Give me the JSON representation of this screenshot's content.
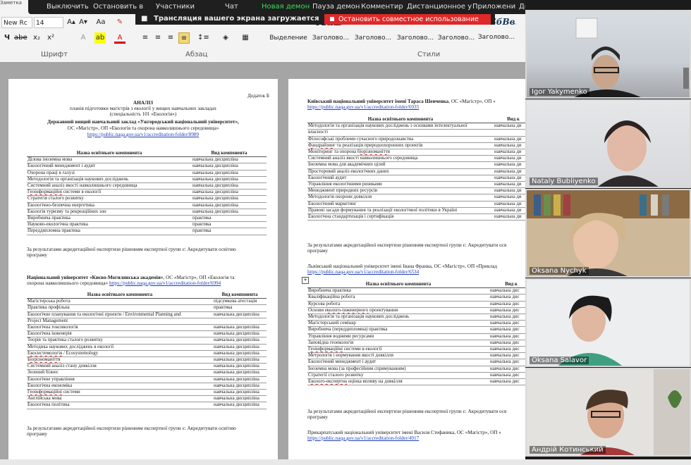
{
  "window": {
    "title_fragment": "Заметка ст"
  },
  "meeting": {
    "controls": [
      "Выключить",
      "Остановить в",
      "Участники",
      "Чат",
      "Новая демон",
      "Пауза демон",
      "Комментир",
      "Дистанционное у",
      "Приложени",
      "Дополнит"
    ],
    "share_status": "Трансляция вашего экрана загружается",
    "stop_share": "Остановить совместное использование"
  },
  "ribbon": {
    "font_name": "New Rc",
    "font_size": "14",
    "font_group": "Шрифт",
    "paragraph_group": "Абзац",
    "styles_group": "Стили",
    "styles": [
      {
        "sample": "АаБбВ",
        "name": "Выделение"
      },
      {
        "sample": "AaB",
        "name": "Заголово..."
      },
      {
        "sample": "АаБбВ",
        "name": "Заголово..."
      },
      {
        "sample": "АаБбВ",
        "name": "Заголово..."
      },
      {
        "sample": "АаБбВ",
        "name": "Заголово..."
      },
      {
        "sample": "АаБбВ",
        "name": "Заголово..."
      },
      {
        "sample": "АаБбВв.",
        "name": "Заголово..."
      }
    ]
  },
  "doc_left": {
    "addendum": "Додаток Б",
    "heading1": "АНАЛІЗ",
    "heading2": "планів підготовки магістрів з екології у вищих навчальних закладах",
    "heading3": "(спеціальність 101 «Екологія»)",
    "uni1": "Державний вищий навчальний заклад «Ужгородський національний університет»,",
    "uni1_prog": "ОС «Магістр», ОП «Екологія та охорона навколишнього середовища»",
    "uni1_link": "https://public.naqa.gov.ua/v1/accreditation-folder/8989",
    "table_h1": "Назва освітнього компонента",
    "table_h2": "Вид компонента",
    "table1": [
      [
        "Ділова іноземна мова",
        "навчальна дисципліна"
      ],
      [
        "Екологічний менеджмент і аудит",
        "навчальна дисципліна"
      ],
      [
        "Охорона праці в галузі",
        "навчальна дисципліна"
      ],
      [
        "Методологія та організація наукових досліджень",
        "навчальна дисципліна"
      ],
      [
        "Системний аналіз якості навколишнього середовища",
        "навчальна дисципліна"
      ],
      [
        "Геоінформаційні системи в екології",
        "навчальна дисципліна"
      ],
      [
        "Стратегія сталого розвитку",
        "навчальна дисципліна"
      ],
      [
        "Екологічно-безпечна енергетика",
        "навчальна дисципліна"
      ],
      [
        "Екологія туризму та рекреаційних зон",
        "навчальна дисципліна"
      ],
      [
        "Виробнича практика",
        "практика"
      ],
      [
        "Науково-екологічна практика",
        "практика"
      ],
      [
        "Переддипломна практика",
        "практика"
      ]
    ],
    "result1": "За результатами акредитаційної експертизи рішенням експертної групи є: Акредитувати освітню",
    "result1b": "програму",
    "uni2": "Національний університет «Києво-Могилянська академія»",
    "uni2_prog": ", ОС «Магістр», ОП «Екологія та",
    "uni2_prog2": "охорона навколишнього середовища»",
    "uni2_link": "https://public.naqa.gov.ua/v1/accreditation-folder/6994",
    "table2": [
      [
        "Магістерська робота",
        "підсумкова атестація"
      ],
      [
        "Практика профільна",
        "практика"
      ],
      [
        "Екологічне планування та екологічні проекти / Environmental Planning and",
        "навчальна дисципліна"
      ],
      [
        "Project Management",
        ""
      ],
      [
        "Екологічна токсикологія",
        "навчальна дисципліна"
      ],
      [
        "Екологічна інженерія",
        "навчальна дисципліна"
      ],
      [
        "Теорія та практика сталого розвитку",
        "навчальна дисципліна"
      ],
      [
        "Методика наукових досліджень в екології",
        "навчальна дисципліна"
      ],
      [
        "Екосистемологія / Ecosystemology",
        "навчальна дисципліна"
      ],
      [
        "Біорізноманіття",
        "навчальна дисципліна"
      ],
      [
        "Системний аналіз стану довкілля",
        "навчальна дисципліна"
      ],
      [
        "Зелений бізнес",
        "навчальна дисципліна"
      ],
      [
        "Екологічне управління",
        "навчальна дисципліна"
      ],
      [
        "Екологічна економіка",
        "навчальна дисципліна"
      ],
      [
        "Геоінформаційні системи",
        "навчальна дисципліна"
      ],
      [
        "Англійська мова",
        "навчальна дисципліна"
      ],
      [
        "Екологічна політика",
        "навчальна дисципліна"
      ]
    ],
    "result2": "За результатами акредитаційної експертизи рішенням експертної групи є: Акредитувати освітню",
    "result2b": "програму"
  },
  "doc_right": {
    "uni3": "Київський національний університет імені Тараса Шевченка",
    "uni3_prog": ", ОС «Магістр», ОП «",
    "uni3_link": "https://public.naqa.gov.ua/v1/accreditation-folder/6935",
    "table_h1": "Назва освітнього компонента",
    "table_h2": "Вид к",
    "table3": [
      [
        "Методологія та організація наукових досліджень з основами інтелектуальної",
        "навчальна ди"
      ],
      [
        "власності",
        ""
      ],
      [
        "Філософські проблеми сучасного природознавства",
        "навчальна ди"
      ],
      [
        "Фандрайзинг та реалізація природоохоронних проектів",
        "навчальна ди"
      ],
      [
        "Моніторинг та охорона біорізноманіття",
        "навчальна ди"
      ],
      [
        "Системний аналіз якості навколишнього середовища",
        "навчальна ди"
      ],
      [
        "Іноземна мова для академічних цілей",
        "навчальна ди"
      ],
      [
        "Просторовий аналіз екологічних даних",
        "навчальна ди"
      ],
      [
        "Екологічний аудит",
        "навчальна ди"
      ],
      [
        "Управління екологічними ризиками",
        "навчальна ди"
      ],
      [
        "Менеджмент природних ресурсів",
        "навчальна ди"
      ],
      [
        "Методологія охорони довкілля",
        "навчальна ди"
      ],
      [
        "Екологічний маркетинг",
        "навчальна ди"
      ],
      [
        "Правові засади формування та реалізації екологічної політики в Україні",
        "навчальна ди"
      ],
      [
        "Екологічна стандартизація і сертифікація",
        "навчальна ди"
      ]
    ],
    "result3": "За результатами акредитаційної експертизи рішенням експертної групи є: Акредитувати осв",
    "result3b": "програму",
    "uni4": "Львівський національний університет імені Івана Франка, ОС «Магістр», ОП «Приклад",
    "uni4_link": "https://public.naqa.gov.ua/v1/accreditation-folder/6534",
    "table4": [
      [
        "Виробнича практика",
        "навчальна дис"
      ],
      [
        "Кваліфікаційна робота",
        "навчальна дис"
      ],
      [
        "Курсова робота",
        "навчальна дис"
      ],
      [
        "Основи еколого-інженерного проектування",
        "навчальна дис"
      ],
      [
        "Методологія та організація наукових досліджень",
        "навчальна дис"
      ],
      [
        "Магістерський семінар",
        "навчальна дис"
      ],
      [
        "Виробнича (переддипломна) практика",
        "навчальна дис"
      ],
      [
        "Управління водними ресурсами",
        "навчальна дис"
      ],
      [
        "Заповідна геоекологія",
        "навчальна дис"
      ],
      [
        "Геоінформаційні системи в екології",
        "навчальна дис"
      ],
      [
        "Метрологія і нормування якості довкілля",
        "навчальна дис"
      ],
      [
        "Екологічний менеджмент і аудит",
        "навчальна дис"
      ],
      [
        "Іноземна мова (за професійним спрямуванням)",
        "навчальна дис"
      ],
      [
        "Стратегії сталого розвитку",
        "навчальна дис"
      ],
      [
        "Еколого-експертна оцінка впливу на довкілля",
        "навчальна дис"
      ]
    ],
    "result4": "За результатами акредитаційної експертизи рішенням експертної групи є: Акредитувати осв",
    "result4b": "програму",
    "uni5": "Прикарпатський національний університет імені Василя Стефаника, ОС «Магістр», ОП «",
    "uni5_link": "https://public.naqa.gov.ua/v1/accreditation-folder/4917"
  },
  "participants": [
    "Igor Yakymenko",
    "Nataly Bubliyenko",
    "Oksana Nychyk",
    "Oksana Salavor",
    "Андрій Котинський"
  ]
}
